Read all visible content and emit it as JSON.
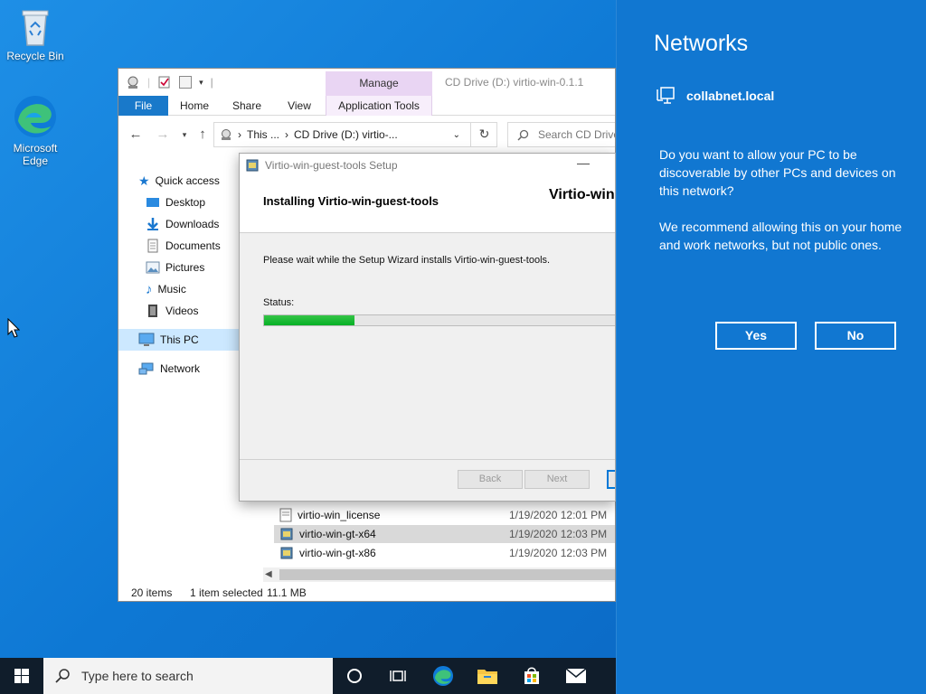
{
  "desktop": {
    "icons": [
      {
        "label": "Recycle Bin"
      },
      {
        "label": "Microsoft Edge"
      }
    ]
  },
  "explorer": {
    "window_title": "CD Drive (D:) virtio-win-0.1.1",
    "manage_tab": "Manage",
    "ribbon_tabs": [
      "File",
      "Home",
      "Share",
      "View",
      "Application Tools"
    ],
    "address": {
      "seg1": "This ...",
      "seg2": "CD Drive (D:) virtio-..."
    },
    "search_placeholder": "Search CD Drive",
    "nav_items": [
      "Quick access",
      "Desktop",
      "Downloads",
      "Documents",
      "Pictures",
      "Music",
      "Videos",
      "This PC",
      "Network"
    ],
    "files": [
      {
        "name": "virtio-win_license",
        "date": "1/19/2020 12:01 PM"
      },
      {
        "name": "virtio-win-gt-x64",
        "date": "1/19/2020 12:03 PM",
        "selected": true
      },
      {
        "name": "virtio-win-gt-x86",
        "date": "1/19/2020 12:03 PM"
      }
    ],
    "status": {
      "items": "20 items",
      "selected": "1 item selected",
      "size": "11.1 MB"
    }
  },
  "setup": {
    "title": "Virtio-win-guest-tools Setup",
    "heading": "Installing Virtio-win-guest-tools",
    "brand": "Virtio-win",
    "message": "Please wait while the Setup Wizard installs Virtio-win-guest-tools.",
    "status_label": "Status:",
    "progress": 0.25,
    "back_label": "Back",
    "next_label": "Next"
  },
  "networks": {
    "title": "Networks",
    "network_name": "collabnet.local",
    "question": "Do you want to allow your PC to be discoverable by other PCs and devices on this network?",
    "recommendation": "We recommend allowing this on your home and work networks, but not public ones.",
    "yes_label": "Yes",
    "no_label": "No"
  },
  "taskbar": {
    "search_placeholder": "Type here to search",
    "icons": [
      "start-icon",
      "cortana-icon",
      "task-view-icon",
      "edge-icon",
      "file-explorer-icon",
      "store-icon",
      "mail-icon"
    ]
  },
  "colors": {
    "accent": "#0078d7",
    "flyout_bg": "#1177d1",
    "progress_fill": "#06b025",
    "taskbar_bg": "#101d2b"
  }
}
